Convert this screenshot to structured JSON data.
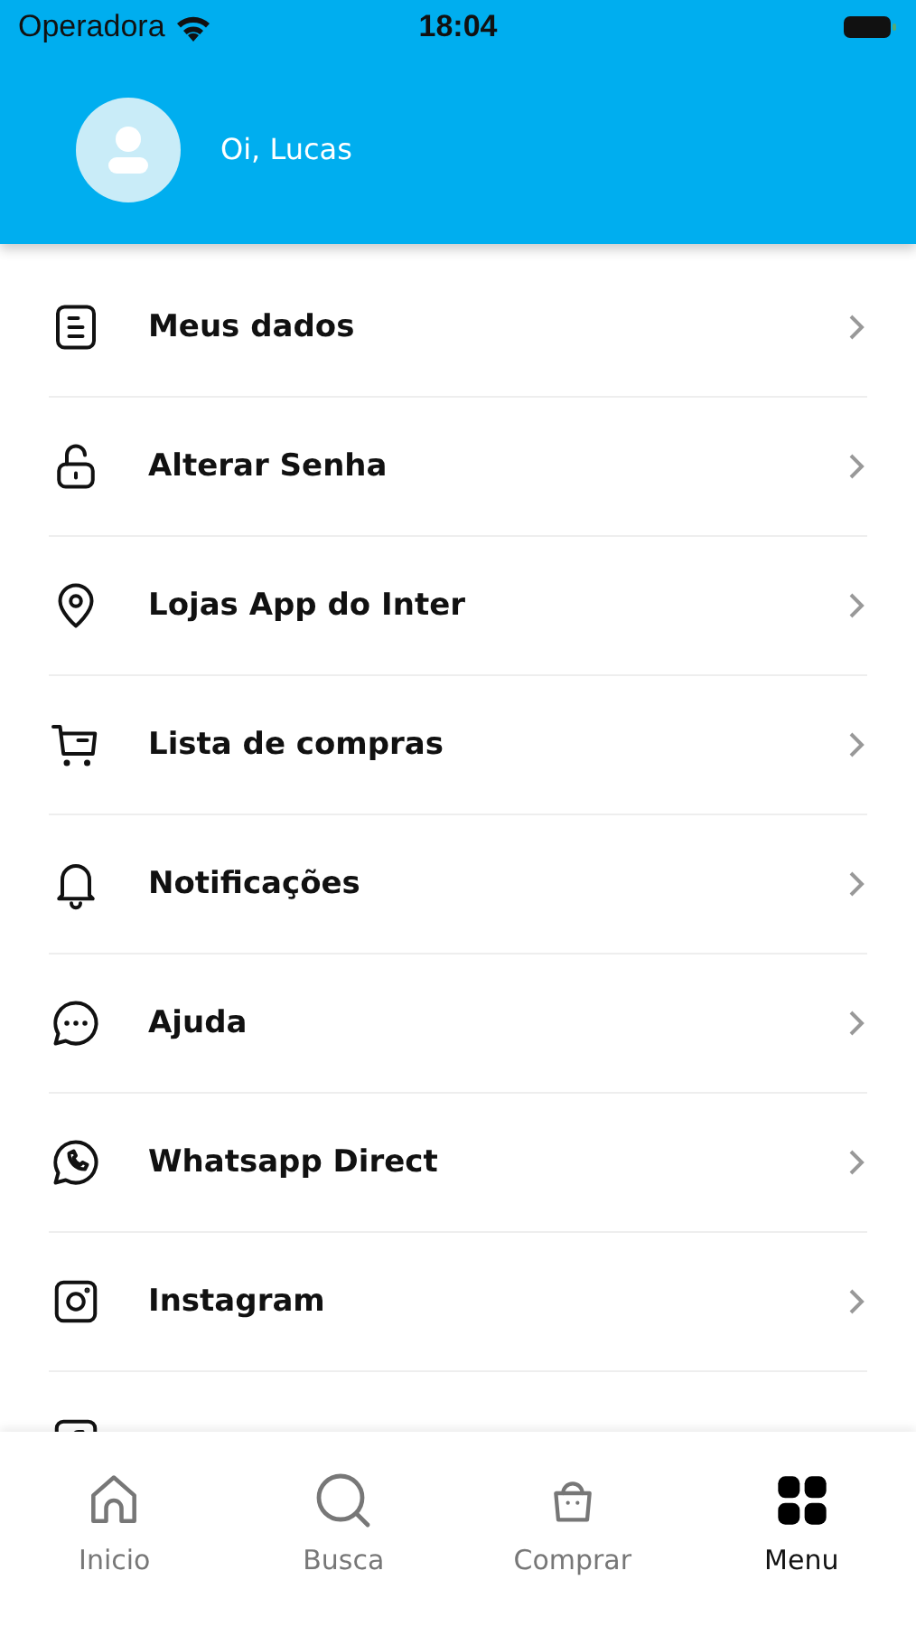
{
  "status_bar": {
    "carrier": "Operadora",
    "time": "18:04"
  },
  "header": {
    "greeting": "Oi, Lucas"
  },
  "menu_items": [
    {
      "label": "Meus dados"
    },
    {
      "label": "Alterar Senha"
    },
    {
      "label": "Lojas App do Inter"
    },
    {
      "label": "Lista de compras"
    },
    {
      "label": "Notificações"
    },
    {
      "label": "Ajuda"
    },
    {
      "label": "Whatsapp Direct"
    },
    {
      "label": "Instagram"
    }
  ],
  "tab_bar": [
    {
      "label": "Inicio",
      "selected": false
    },
    {
      "label": "Busca",
      "selected": false
    },
    {
      "label": "Comprar",
      "selected": false
    },
    {
      "label": "Menu",
      "selected": true
    }
  ]
}
